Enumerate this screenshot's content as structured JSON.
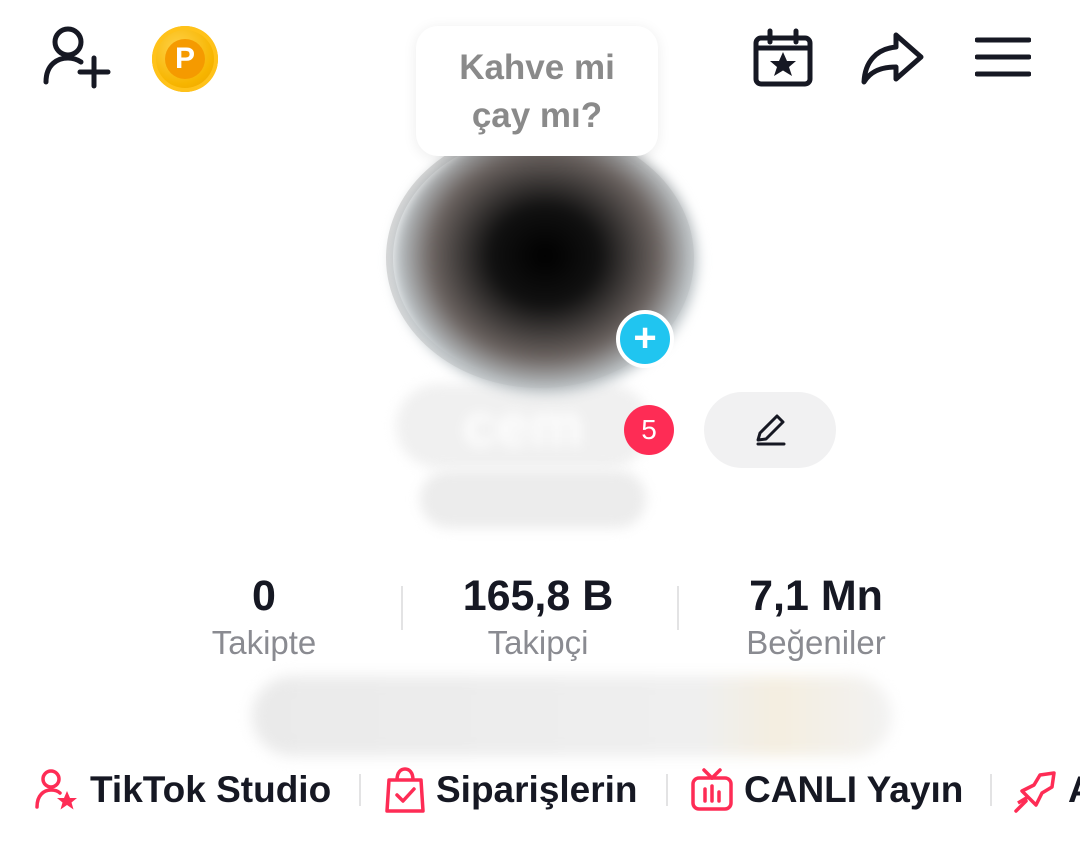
{
  "header": {
    "coin_letter": "P"
  },
  "status_bubble": {
    "line1": "Kahve mi",
    "line2": "çay mı?"
  },
  "profile": {
    "avatar_add": "+",
    "username_blurred": "cem",
    "notification_count": "5"
  },
  "stats": {
    "following": {
      "value": "0",
      "label": "Takipte"
    },
    "followers": {
      "value": "165,8 B",
      "label": "Takipçi"
    },
    "likes": {
      "value": "7,1 Mn",
      "label": "Beğeniler"
    }
  },
  "shortcuts": [
    {
      "label": "TikTok Studio",
      "icon": "creator-star-icon"
    },
    {
      "label": "Siparişlerin",
      "icon": "shopping-bag-icon"
    },
    {
      "label": "CANLI Yayın",
      "icon": "live-tv-icon"
    },
    {
      "label": "A",
      "icon": "promote-icon"
    }
  ],
  "colors": {
    "accent": "#fe2c55",
    "text": "#161823",
    "muted": "#8a8b91",
    "blue": "#20c5f0"
  }
}
